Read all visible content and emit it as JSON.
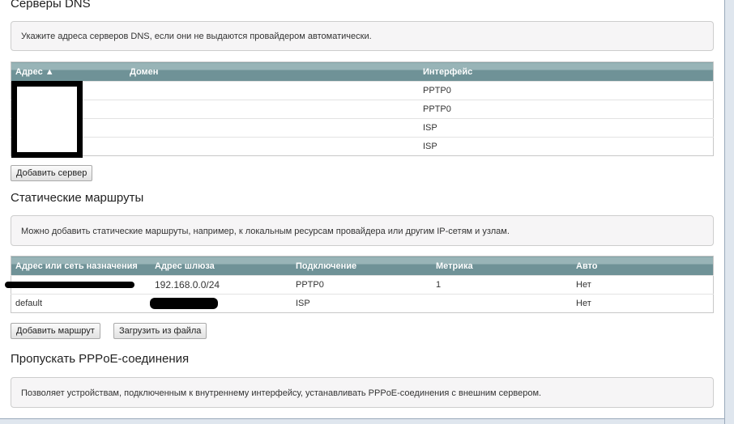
{
  "dns": {
    "title": "Серверы DNS",
    "notice": "Укажите адреса серверов DNS, если они не выдаются провайдером автоматически.",
    "columns": {
      "address": "Адрес ▲",
      "domain": "Домен",
      "interface": "Интерфейс"
    },
    "rows": [
      {
        "address": "",
        "domain": "",
        "interface": "PPTP0"
      },
      {
        "address": "",
        "domain": "",
        "interface": "PPTP0"
      },
      {
        "address": "",
        "domain": "",
        "interface": "ISP"
      },
      {
        "address": "",
        "domain": "",
        "interface": "ISP"
      }
    ],
    "add_button": "Добавить сервер"
  },
  "routes": {
    "title": "Статические маршруты",
    "notice": "Можно добавить статические маршруты, например, к локальным ресурсам провайдера или другим IP-сетям и узлам.",
    "columns": {
      "destination": "Адрес или сеть назначения",
      "gateway": "Адрес шлюза",
      "connection": "Подключение",
      "metric": "Метрика",
      "auto": "Авто"
    },
    "rows": [
      {
        "destination": "",
        "gateway": "192.168.0.0/24",
        "connection": "PPTP0",
        "metric": "1",
        "auto": "Нет"
      },
      {
        "destination": "default",
        "gateway": "",
        "connection": "ISP",
        "metric": "",
        "auto": "Нет"
      }
    ],
    "add_button": "Добавить маршрут",
    "load_button": "Загрузить из файла"
  },
  "pppoe": {
    "title": "Пропускать PPPoE-соединения",
    "notice": "Позволяет устройствам, подключенным к внутреннему интерфейсу, устанавливать PPPoE-соединения с внешним сервером."
  }
}
